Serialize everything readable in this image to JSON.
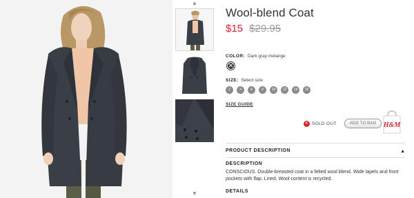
{
  "product": {
    "title": "Wool-blend Coat",
    "price_now": "$15",
    "price_old": "$29.95"
  },
  "color": {
    "label": "COLOR:",
    "value": "Dark gray melange",
    "swatch_hex": "#34373c"
  },
  "size": {
    "label": "SIZE:",
    "value": "Select size",
    "options": [
      "2",
      "4",
      "6",
      "8",
      "10",
      "12",
      "14",
      "16"
    ]
  },
  "size_guide": "SIZE GUIDE",
  "availability": {
    "status": "SOLD OUT",
    "add_to_bag": "ADD TO BAG",
    "brand_logo": "H&M"
  },
  "accordion": {
    "product_description": "PRODUCT DESCRIPTION",
    "description_heading": "DESCRIPTION",
    "description_text": "CONSCIOUS. Double-breasted coat in a felted wool blend. Wide lapels and front pockets with flap. Lined. Wool content is recycled.",
    "details_heading": "DETAILS"
  },
  "thumbnails": {
    "up_arrow_icon": "chevron-up-icon",
    "down_arrow_icon": "chevron-down-icon",
    "count": 3
  },
  "colors": {
    "sale_red": "#d6252c",
    "coat": "#3a3e45",
    "button_gray": "#8a8a8a"
  }
}
